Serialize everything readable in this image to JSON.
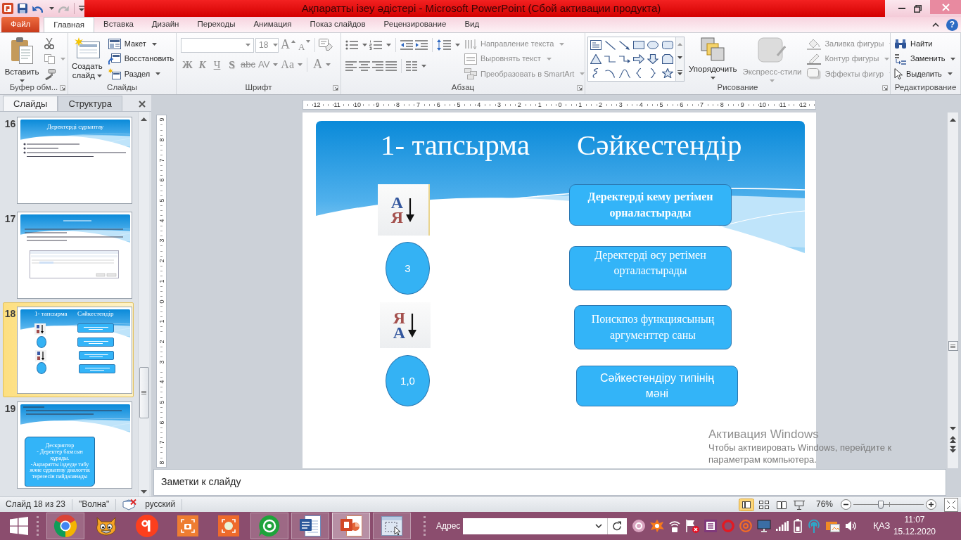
{
  "window": {
    "title": "Ақпаратты ізеу әдістері - Microsoft PowerPoint (Сбой активации продукта)",
    "help": "?"
  },
  "quick_access": [
    {
      "kind": "save",
      "disabled": false
    },
    {
      "kind": "undo",
      "disabled": false
    },
    {
      "kind": "redo",
      "disabled": true
    }
  ],
  "ribbon_tabs": [
    {
      "kind": "file",
      "label": "Файл",
      "selected": false
    },
    {
      "kind": "tab",
      "label": "Главная",
      "selected": true
    },
    {
      "kind": "tab",
      "label": "Вставка",
      "selected": false
    },
    {
      "kind": "tab",
      "label": "Дизайн",
      "selected": false
    },
    {
      "kind": "tab",
      "label": "Переходы",
      "selected": false
    },
    {
      "kind": "tab",
      "label": "Анимация",
      "selected": false
    },
    {
      "kind": "tab",
      "label": "Показ слайдов",
      "selected": false
    },
    {
      "kind": "tab",
      "label": "Рецензирование",
      "selected": false
    },
    {
      "kind": "tab",
      "label": "Вид",
      "selected": false
    }
  ],
  "ribbon": {
    "clipboard": {
      "label": "Буфер обм...",
      "paste": "Вставить",
      "copy": {
        "disabled": true
      }
    },
    "slides": {
      "label": "Слайды",
      "new_slide": "Создать слайд",
      "commands": [
        {
          "label": "Макет",
          "dropdown": true
        },
        {
          "label": "Восстановить",
          "dropdown": false
        },
        {
          "label": "Раздел",
          "dropdown": true
        }
      ]
    },
    "font": {
      "label": "Шрифт",
      "disabled": true,
      "size": "18",
      "size_buttons": [
        {
          "kind": "grow",
          "label": "A"
        },
        {
          "kind": "shrink",
          "label": "A"
        }
      ],
      "format_buttons": [
        {
          "kind": "bold",
          "label": "Ж"
        },
        {
          "kind": "italic",
          "label": "К"
        },
        {
          "kind": "underline",
          "label": "Ч"
        },
        {
          "kind": "shadow",
          "label": "S"
        },
        {
          "kind": "strike",
          "label": "abc"
        },
        {
          "kind": "spacing",
          "label": "AV"
        },
        {
          "kind": "case",
          "label": "Aa"
        },
        {
          "kind": "color",
          "label": "A"
        }
      ]
    },
    "paragraph": {
      "label": "Абзац",
      "commands": [
        {
          "label": "Направление текста",
          "disabled": true
        },
        {
          "label": "Выровнять текст",
          "disabled": true
        },
        {
          "label": "Преобразовать в SmartArt",
          "disabled": true
        }
      ]
    },
    "drawing": {
      "label": "Рисование",
      "arrange": {
        "label": "Упорядочить",
        "disabled": false
      },
      "quick_styles": {
        "label": "Экспресс-стили",
        "disabled": true
      },
      "commands": [
        {
          "label": "Заливка фигуры",
          "disabled": true
        },
        {
          "label": "Контур фигуры",
          "disabled": true
        },
        {
          "label": "Эффекты фигур",
          "disabled": true
        }
      ]
    },
    "editing": {
      "label": "Редактирование",
      "commands": [
        {
          "label": "Найти",
          "dropdown": false
        },
        {
          "label": "Заменить",
          "dropdown": true
        },
        {
          "label": "Выделить",
          "dropdown": true
        }
      ]
    }
  },
  "slide_panel": {
    "tabs": [
      {
        "label": "Слайды",
        "selected": true
      },
      {
        "label": "Структура",
        "selected": false
      }
    ],
    "thumbnails": [
      {
        "number": "16",
        "kind": "bullets",
        "selected": false,
        "title": "Деректерді сұрыптау"
      },
      {
        "number": "17",
        "kind": "dialog",
        "selected": false
      },
      {
        "number": "18",
        "kind": "matching",
        "selected": true,
        "title": "1- тапсырма",
        "heading": "Сәйкестендір"
      },
      {
        "number": "19",
        "kind": "scroll",
        "selected": false,
        "scroll_text": "Дескриптор\n- Деректер базасын құрады.\n-Ақпаратты іздеуде табу және сұрыптау диалогтік терезесін пайдаланады"
      }
    ]
  },
  "rulers": {
    "horizontal": [
      "12",
      "11",
      "10",
      "9",
      "8",
      "7",
      "6",
      "5",
      "4",
      "3",
      "2",
      "1",
      "0",
      "1",
      "2",
      "3",
      "4",
      "5",
      "6",
      "7",
      "8",
      "9",
      "10",
      "11",
      "12"
    ],
    "vertical": [
      "9",
      "8",
      "7",
      "6",
      "5",
      "4",
      "3",
      "2",
      "1",
      "0",
      "1",
      "2",
      "3",
      "4",
      "5",
      "6",
      "7",
      "8"
    ]
  },
  "slide": {
    "title": "1- тапсырма",
    "heading": "Сәйкестендір",
    "left_items": [
      {
        "kind": "sort_ascending",
        "letters": [
          "А",
          "Я"
        ]
      },
      {
        "kind": "circle",
        "label": "3"
      },
      {
        "kind": "sort_descending",
        "letters": [
          "Я",
          "А"
        ]
      },
      {
        "kind": "circle",
        "label": "1,0"
      }
    ],
    "right_boxes": [
      "Деректерді кему ретімен орналастырады",
      "Деректерді өсу ретімен орталастырады",
      "Поискпоз функциясының аргументтер саны",
      "Сәйкестендіру типінің мәні"
    ]
  },
  "notes": {
    "placeholder": "Заметки к слайду"
  },
  "activation_notice": {
    "title": "Активация Windows",
    "text": "Чтобы активировать Windows, перейдите к параметрам компьютера."
  },
  "status_bar": {
    "slide_info": "Слайд 18 из 23",
    "theme": "\"Волна\"",
    "language": "русский",
    "views": [
      {
        "kind": "normal",
        "selected": true
      },
      {
        "kind": "sorter",
        "selected": false
      },
      {
        "kind": "reading",
        "selected": false
      },
      {
        "kind": "slideshow",
        "selected": false
      }
    ],
    "zoom": "76%",
    "zoom_slider": {
      "level": 0.4
    }
  },
  "taskbar": {
    "apps": [
      {
        "kind": "browser",
        "running": true,
        "selected": false
      },
      {
        "kind": "cat",
        "running": false,
        "selected": false
      },
      {
        "kind": "ya",
        "running": false,
        "selected": false
      },
      {
        "kind": "camera",
        "running": false,
        "selected": false
      },
      {
        "kind": "record",
        "running": false,
        "selected": false
      },
      {
        "kind": "mail",
        "running": true,
        "selected": false
      },
      {
        "kind": "word",
        "running": true,
        "selected": false
      },
      {
        "kind": "slides",
        "running": true,
        "selected": true
      },
      {
        "kind": "snip",
        "running": true,
        "selected": false
      }
    ],
    "address_label": "Адрес",
    "language": "ҚАЗ",
    "time": "11:07",
    "date": "15.12.2020"
  }
}
